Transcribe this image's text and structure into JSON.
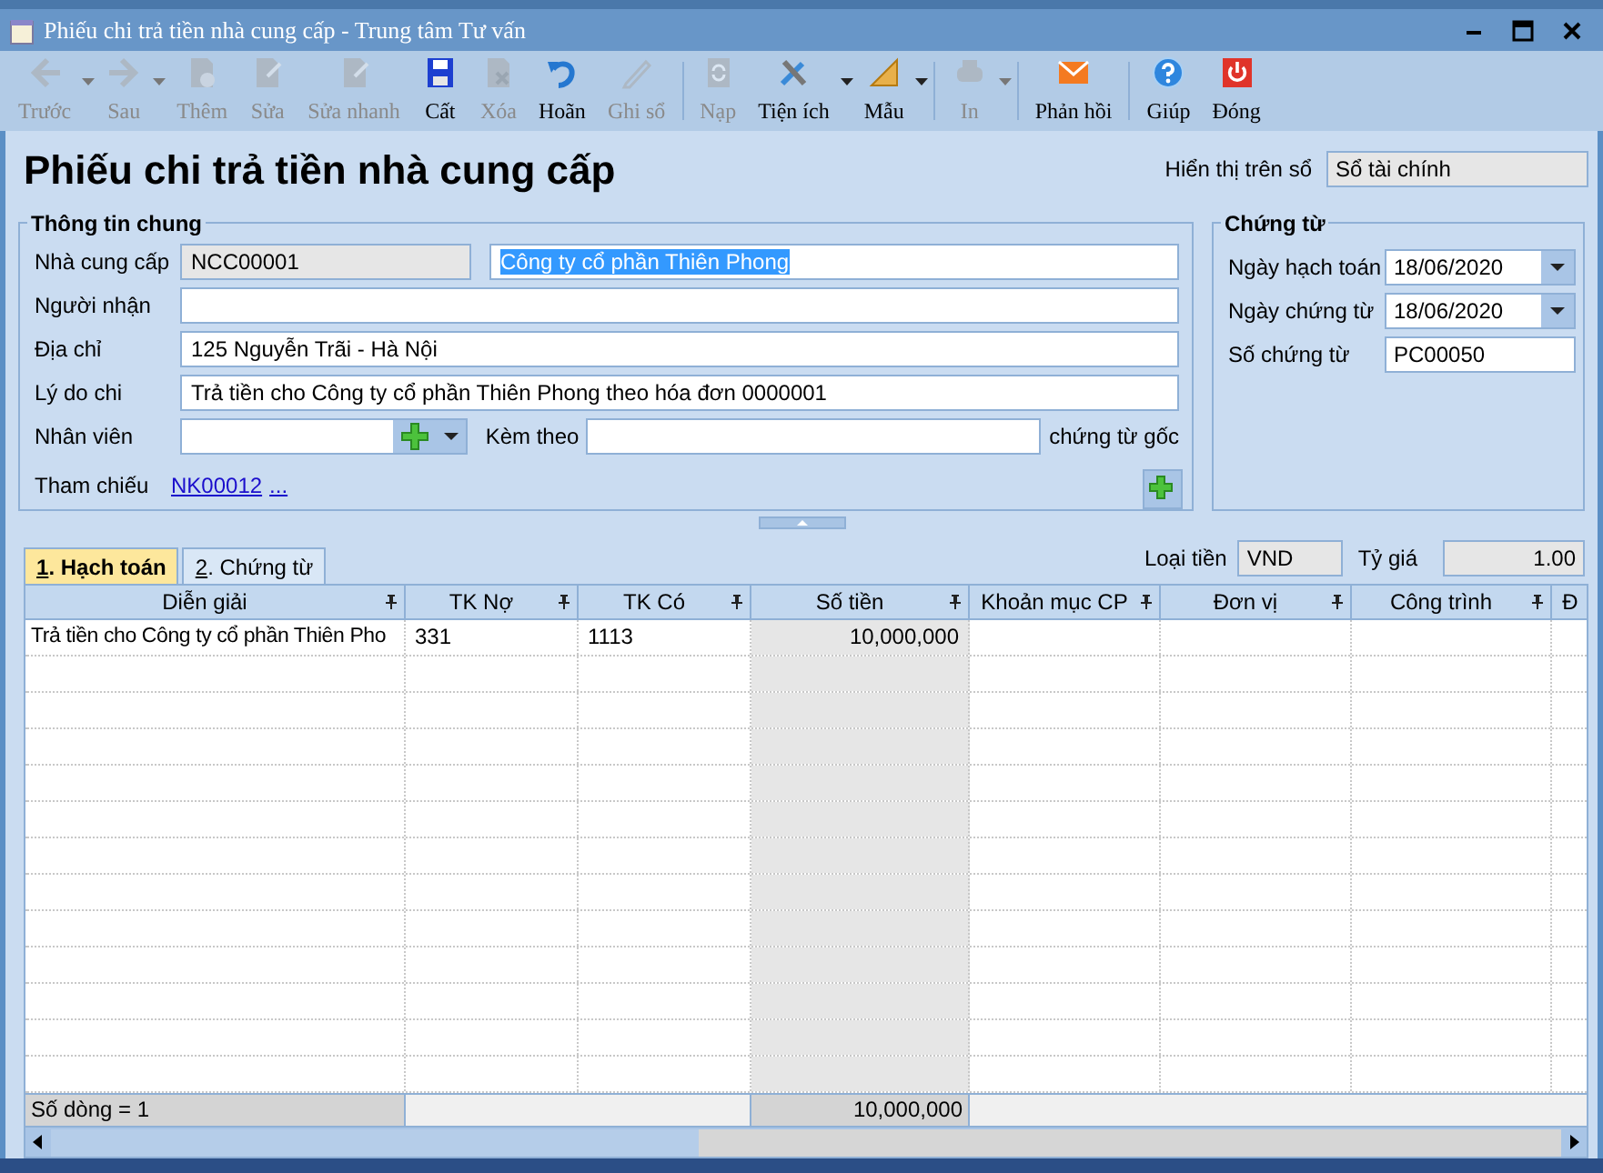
{
  "window": {
    "title": "Phiếu chi trả tiền nhà cung cấp - Trung tâm Tư vấn"
  },
  "toolbar": [
    {
      "label": "Trước",
      "enabled": false,
      "dropdown": true,
      "separator_after": false
    },
    {
      "label": "Sau",
      "enabled": false,
      "dropdown": true,
      "separator_after": false
    },
    {
      "label": "Thêm",
      "enabled": false,
      "dropdown": false,
      "separator_after": false
    },
    {
      "label": "Sửa",
      "enabled": false,
      "dropdown": false,
      "separator_after": false
    },
    {
      "label": "Sửa nhanh",
      "enabled": false,
      "dropdown": false,
      "separator_after": false
    },
    {
      "label": "Cất",
      "enabled": true,
      "dropdown": false,
      "separator_after": false
    },
    {
      "label": "Xóa",
      "enabled": false,
      "dropdown": false,
      "separator_after": false
    },
    {
      "label": "Hoãn",
      "enabled": true,
      "dropdown": false,
      "separator_after": false
    },
    {
      "label": "Ghi sổ",
      "enabled": false,
      "dropdown": false,
      "separator_after": true
    },
    {
      "label": "Nạp",
      "enabled": false,
      "dropdown": false,
      "separator_after": false
    },
    {
      "label": "Tiện ích",
      "enabled": true,
      "dropdown": true,
      "separator_after": false
    },
    {
      "label": "Mẫu",
      "enabled": true,
      "dropdown": true,
      "separator_after": true
    },
    {
      "label": "In",
      "enabled": false,
      "dropdown": true,
      "separator_after": true
    },
    {
      "label": "Phản hồi",
      "enabled": true,
      "dropdown": false,
      "separator_after": true
    },
    {
      "label": "Giúp",
      "enabled": true,
      "dropdown": false,
      "separator_after": false
    },
    {
      "label": "Đóng",
      "enabled": true,
      "dropdown": false,
      "separator_after": false
    }
  ],
  "form_title": "Phiếu chi trả tiền nhà cung cấp",
  "display_on": {
    "label": "Hiển thị trên sổ",
    "value": "Sổ tài chính"
  },
  "general_info": {
    "title": "Thông tin chung",
    "supplier": {
      "label": "Nhà cung cấp",
      "code": "NCC00001",
      "name": "Công ty cổ phần Thiên Phong",
      "selected": true
    },
    "recipient": {
      "label": "Người nhận"
    },
    "address": {
      "label": "Địa chỉ",
      "value": "125 Nguyễn Trãi - Hà Nội"
    },
    "reason": {
      "label": "Lý do chi",
      "value": "Trả tiền cho Công ty cổ phần Thiên Phong theo hóa đơn 0000001"
    },
    "employee": {
      "label": "Nhân viên"
    },
    "attachments": {
      "label": "Kèm theo",
      "suffix": "chứng từ gốc"
    },
    "reference": {
      "label": "Tham chiếu",
      "link": "NK00012",
      "more": "..."
    }
  },
  "voucher": {
    "title": "Chứng từ",
    "fields": [
      {
        "kind": "date",
        "label": "Ngày hạch toán",
        "value": "18/06/2020"
      },
      {
        "kind": "date",
        "label": "Ngày chứng từ",
        "value": "18/06/2020"
      },
      {
        "kind": "text",
        "label": "Số chứng từ",
        "value": "PC00050"
      }
    ]
  },
  "tabs": [
    {
      "label": "1. Hạch toán",
      "selected": true
    },
    {
      "label": "2. Chứng từ",
      "selected": false
    }
  ],
  "currency": {
    "label": "Loại tiền",
    "value": "VND"
  },
  "rate": {
    "label": "Tỷ giá",
    "value": "1.00"
  },
  "table": {
    "columns": [
      {
        "label": "Diễn giải"
      },
      {
        "label": "TK Nợ"
      },
      {
        "label": "TK Có"
      },
      {
        "label": "Số tiền"
      },
      {
        "label": "Khoản mục CP"
      },
      {
        "label": "Đơn vị"
      },
      {
        "label": "Công trình"
      },
      {
        "label": "Đ"
      }
    ],
    "rows": [
      {
        "cells": [
          "Trả tiền cho Công ty cổ phần Thiên Pho",
          "331",
          "1113",
          "10,000,000"
        ]
      }
    ],
    "footer": {
      "count": "Số dòng = 1",
      "total": "10,000,000"
    }
  }
}
